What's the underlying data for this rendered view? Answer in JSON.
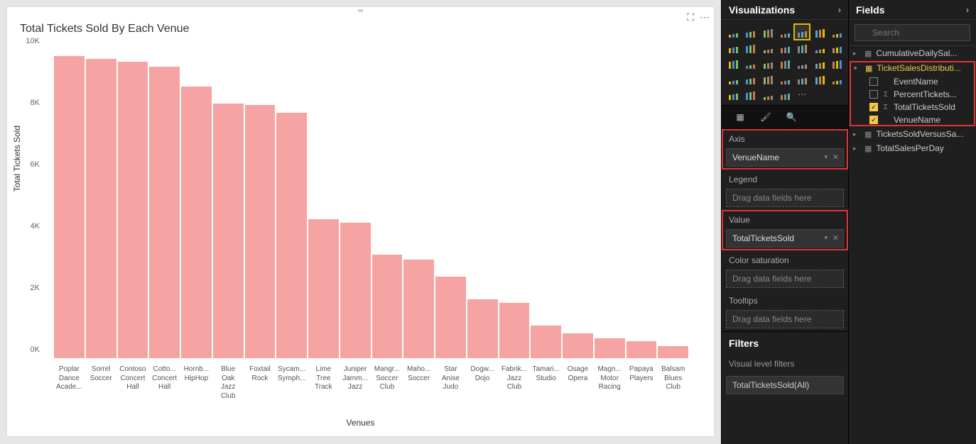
{
  "chart": {
    "title": "Total Tickets Sold By Each Venue",
    "xlabel": "Venues",
    "ylabel": "Total Tickets Sold"
  },
  "chart_data": {
    "type": "bar",
    "title": "Total Tickets Sold By Each Venue",
    "xlabel": "Venues",
    "ylabel": "Total Tickets Sold",
    "ylim": [
      0,
      10000
    ],
    "yticks": [
      "0K",
      "2K",
      "4K",
      "6K",
      "8K",
      "10K"
    ],
    "categories": [
      "Poplar Dance Acade...",
      "Sorrel Soccer",
      "Contoso Concert Hall",
      "Cotto... Concert Hall",
      "Hornb... HipHop",
      "Blue Oak Jazz Club",
      "Foxtail Rock",
      "Sycam... Symph...",
      "Lime Tree Track",
      "Juniper Jamm... Jazz",
      "Mangr... Soccer Club",
      "Maho... Soccer",
      "Star Anise Judo",
      "Dogw... Dojo",
      "Fabrik... Jazz Club",
      "Tamari... Studio",
      "Osage Opera",
      "Magn... Motor Racing",
      "Papaya Players",
      "Balsam Blues Club"
    ],
    "values": [
      9800,
      9700,
      9600,
      9450,
      8800,
      8250,
      8200,
      7950,
      4500,
      4400,
      3350,
      3200,
      2650,
      1900,
      1800,
      1050,
      800,
      650,
      550,
      400
    ]
  },
  "viz_panel": {
    "title": "Visualizations",
    "tabs": {
      "fields": "Fields",
      "format": "Format",
      "analytics": "Analytics"
    },
    "wells": {
      "axis_label": "Axis",
      "axis_value": "VenueName",
      "legend_label": "Legend",
      "legend_placeholder": "Drag data fields here",
      "value_label": "Value",
      "value_value": "TotalTicketsSold",
      "colorsat_label": "Color saturation",
      "colorsat_placeholder": "Drag data fields here",
      "tooltips_label": "Tooltips",
      "tooltips_placeholder": "Drag data fields here"
    },
    "filters": {
      "header": "Filters",
      "sub": "Visual level filters",
      "item": "TotalTicketsSold(All)"
    }
  },
  "fields_panel": {
    "title": "Fields",
    "search_placeholder": "Search",
    "tables": {
      "t1": "CumulativeDailySal...",
      "t2": "TicketSalesDistributi...",
      "t3": "TicketsSoldVersusSa...",
      "t4": "TotalSalesPerDay"
    },
    "fields": {
      "f1": "EventName",
      "f2": "PercentTickets...",
      "f3": "TotalTicketsSold",
      "f4": "VenueName"
    }
  }
}
